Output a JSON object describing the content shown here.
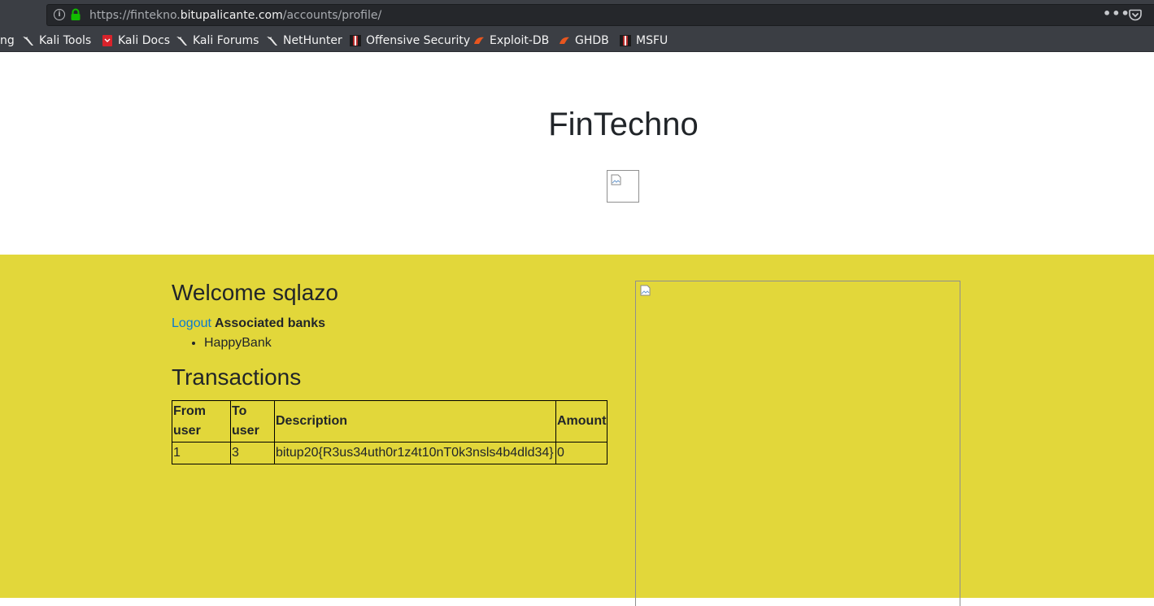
{
  "browser": {
    "url": {
      "prefix": "https://fintekno.",
      "host": "bitupalicante.com",
      "path": "/accounts/profile/"
    },
    "bookmarks": [
      {
        "label": "ng",
        "icon": "none"
      },
      {
        "label": "Kali Tools",
        "icon": "kali-dragon-icon"
      },
      {
        "label": "Kali Docs",
        "icon": "kali-docs-icon"
      },
      {
        "label": "Kali Forums",
        "icon": "kali-dragon-icon"
      },
      {
        "label": "NetHunter",
        "icon": "kali-dragon-icon"
      },
      {
        "label": "Offensive Security",
        "icon": "offsec-icon"
      },
      {
        "label": "Exploit-DB",
        "icon": "exploitdb-icon"
      },
      {
        "label": "GHDB",
        "icon": "exploitdb-icon"
      },
      {
        "label": "MSFU",
        "icon": "offsec-icon"
      }
    ]
  },
  "header": {
    "title": "FinTechno"
  },
  "profile": {
    "welcome": "Welcome sqlazo",
    "logout_label": "Logout",
    "associated_label": "Associated banks",
    "banks": [
      "HappyBank"
    ],
    "transactions_title": "Transactions",
    "table": {
      "headers": [
        "From user",
        "To user",
        "Description",
        "Amount"
      ],
      "rows": [
        [
          "1",
          "3",
          "bitup20{R3us34uth0r1z4t10nT0k3nsls4b4dld34}",
          "0"
        ]
      ]
    }
  },
  "colors": {
    "content_background": "#e2d73a",
    "link": "#0b7ad0",
    "chrome": "#3b3e44"
  }
}
